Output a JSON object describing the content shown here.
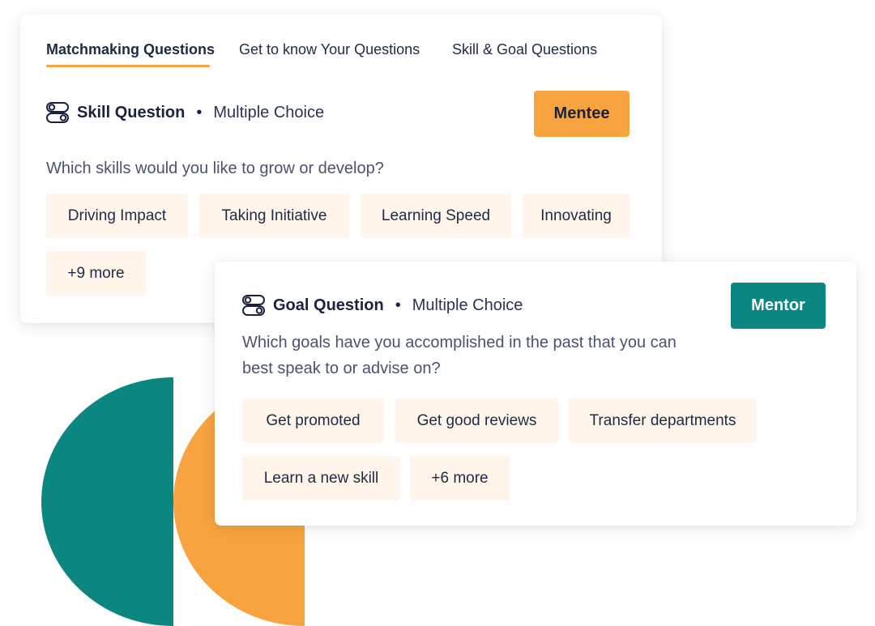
{
  "colors": {
    "accent_orange": "#f7a33f",
    "accent_teal": "#0c8680",
    "chip_bg": "#fff5ea",
    "text_dark": "#1f2a44"
  },
  "tabs": [
    {
      "label": "Matchmaking Questions",
      "active": true
    },
    {
      "label": "Get to know Your Questions",
      "active": false
    },
    {
      "label": "Skill & Goal Questions",
      "active": false
    }
  ],
  "skill_card": {
    "icon": "toggle-icon",
    "title": "Skill Question",
    "separator": "•",
    "type": "Multiple Choice",
    "role_button": "Mentee",
    "question": "Which skills would you like to grow or develop?",
    "options": [
      "Driving Impact",
      "Taking Initiative",
      "Learning Speed",
      "Innovating",
      "+9 more"
    ]
  },
  "goal_card": {
    "icon": "toggle-icon",
    "title": "Goal Question",
    "separator": "•",
    "type": "Multiple Choice",
    "role_button": "Mentor",
    "question_line1": "Which goals have you accomplished in the past that you can",
    "question_line2": "best speak to or advise on?",
    "options": [
      "Get promoted",
      "Get good reviews",
      "Transfer departments",
      "Learn a new skill",
      "+6 more"
    ]
  }
}
